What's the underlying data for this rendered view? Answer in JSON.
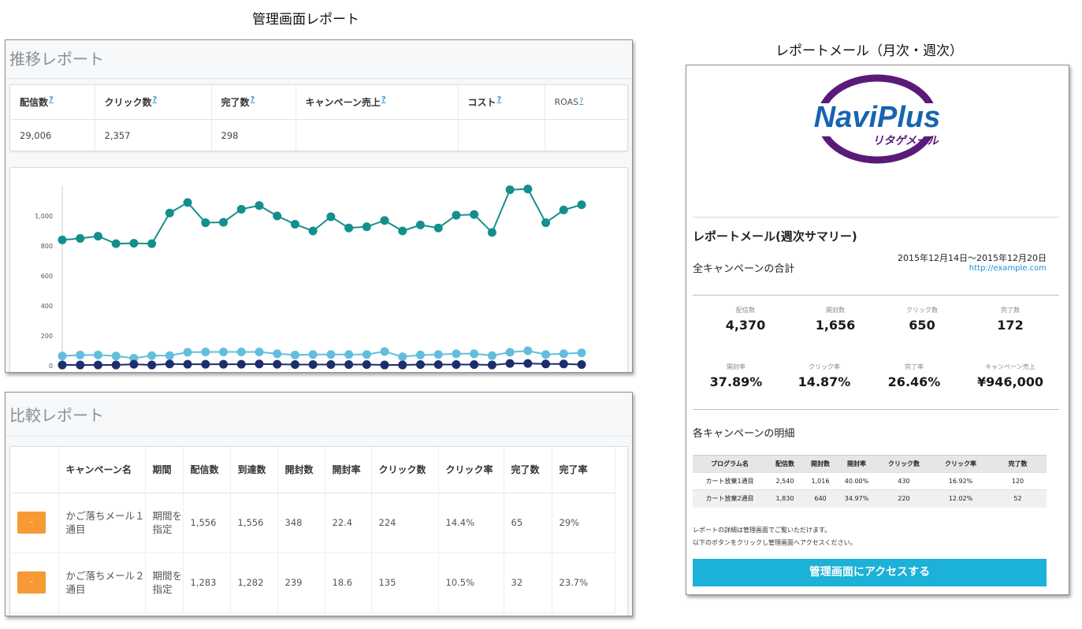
{
  "captions": {
    "admin": "管理画面レポート",
    "mail": "レポートメール（月次・週次）"
  },
  "trend_report": {
    "title": "推移レポート",
    "stats": {
      "headers": [
        "配信数",
        "クリック数",
        "完了数",
        "キャンペーン売上",
        "コスト",
        "ROAS"
      ],
      "help": "?",
      "values": [
        "29,006",
        "2,357",
        "298",
        "",
        "",
        ""
      ]
    }
  },
  "chart_data": {
    "type": "line",
    "yticks": [
      "0",
      "200",
      "400",
      "600",
      "800",
      "1,000"
    ],
    "ylim": [
      0,
      1200
    ],
    "series": [
      {
        "color": "#138f8d",
        "values": [
          840,
          850,
          865,
          815,
          818,
          815,
          1020,
          1090,
          955,
          958,
          1045,
          1070,
          1000,
          945,
          900,
          995,
          920,
          928,
          970,
          900,
          940,
          920,
          1005,
          1010,
          890,
          1175,
          1180,
          955,
          1040,
          1075
        ]
      },
      {
        "color": "#62bedd",
        "values": [
          65,
          72,
          72,
          65,
          50,
          68,
          68,
          90,
          92,
          92,
          92,
          92,
          80,
          72,
          75,
          75,
          75,
          75,
          95,
          60,
          72,
          75,
          80,
          80,
          68,
          90,
          100,
          75,
          80,
          86
        ]
      },
      {
        "color": "#1d2d6e",
        "values": [
          5,
          5,
          5,
          5,
          10,
          5,
          12,
          10,
          10,
          10,
          10,
          12,
          10,
          8,
          8,
          8,
          8,
          8,
          5,
          5,
          8,
          8,
          8,
          8,
          5,
          15,
          15,
          12,
          12,
          8
        ]
      }
    ]
  },
  "compare_report": {
    "title": "比較レポート",
    "headers": [
      "",
      "キャンペーン名",
      "期間",
      "配信数",
      "到達数",
      "開封数",
      "開封率",
      "クリック数",
      "クリック率",
      "完了数",
      "完了率"
    ],
    "rows": [
      {
        "button": "-",
        "name": "かご落ちメール１通目",
        "period": "期間を指定",
        "cells": [
          "1,556",
          "1,556",
          "348",
          "22.4",
          "224",
          "14.4%",
          "65",
          "29%"
        ]
      },
      {
        "button": "-",
        "name": "かご落ちメール２通目",
        "period": "期間を指定",
        "cells": [
          "1,283",
          "1,282",
          "239",
          "18.6",
          "135",
          "10.5%",
          "32",
          "23.7%"
        ]
      }
    ]
  },
  "mail": {
    "logo": {
      "brand": "NaviPlus",
      "sub": "リタゲメール",
      "colors": {
        "arc": "#5a1a78",
        "text": "#1764b0"
      }
    },
    "title": "レポートメール(週次サマリー)",
    "summary_label": "全キャンペーンの合計",
    "date_range": "2015年12月14日～2015年12月20日",
    "url": "http://example.com",
    "kpis": [
      {
        "label": "配信数",
        "value": "4,370"
      },
      {
        "label": "開封数",
        "value": "1,656"
      },
      {
        "label": "クリック数",
        "value": "650"
      },
      {
        "label": "完了数",
        "value": "172"
      },
      {
        "label": "開封率",
        "value": "37.89%"
      },
      {
        "label": "クリック率",
        "value": "14.87%"
      },
      {
        "label": "完了率",
        "value": "26.46%"
      },
      {
        "label": "キャンペーン売上",
        "value": "¥946,000"
      }
    ],
    "detail_title": "各キャンペーンの明細",
    "table": {
      "headers": [
        "プログラム名",
        "配信数",
        "開封数",
        "開封率",
        "クリック数",
        "クリック率",
        "完了数"
      ],
      "rows": [
        [
          "カート放棄1通目",
          "2,540",
          "1,016",
          "40.00%",
          "430",
          "16.92%",
          "120"
        ],
        [
          "カート放棄2通目",
          "1,830",
          "640",
          "34.97%",
          "220",
          "12.02%",
          "52"
        ]
      ]
    },
    "note_lines": [
      "レポートの詳細は管理画面でご覧いただけます。",
      "以下のボタンをクリックし管理画面へアクセスください。"
    ],
    "button": "管理画面にアクセスする"
  }
}
